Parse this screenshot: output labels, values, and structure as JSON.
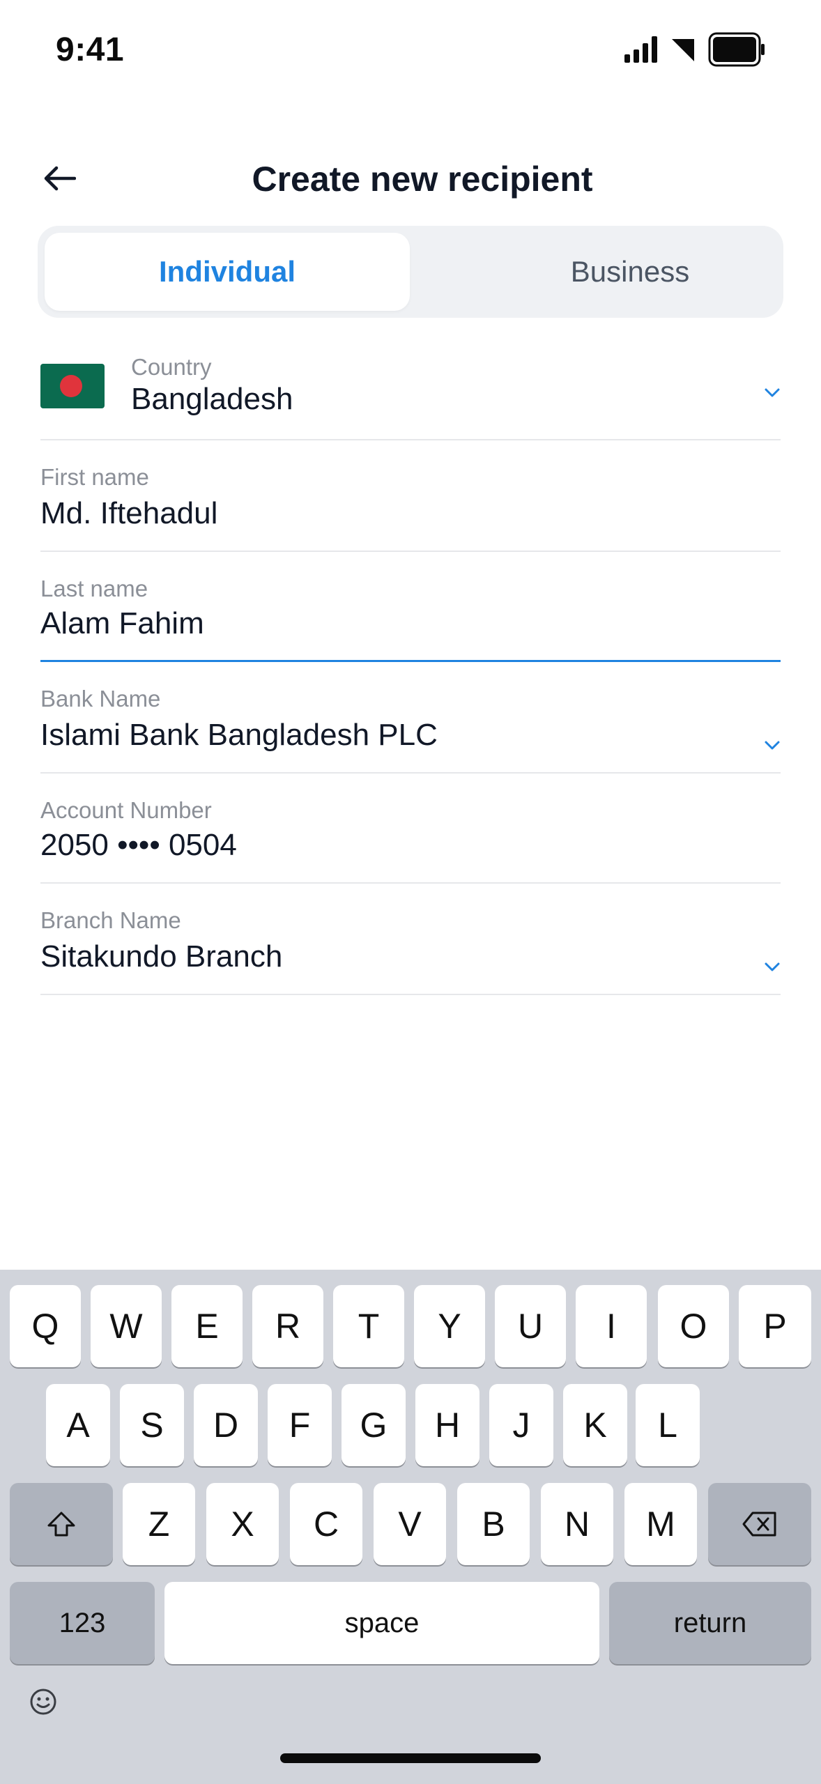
{
  "status_bar": {
    "time": "9:41"
  },
  "header": {
    "title": "Create new recipient"
  },
  "tabs": [
    {
      "label": "Individual",
      "selected": true
    },
    {
      "label": "Business",
      "selected": false
    }
  ],
  "form": {
    "country": {
      "label": "Country",
      "value": "Bangladesh",
      "flag": "bangladesh-flag"
    },
    "first_name": {
      "label": "First name",
      "value": "Md. Iftehadul"
    },
    "last_name": {
      "label": "Last name",
      "value": "Alam Fahim"
    },
    "bank_name": {
      "label": "Bank Name",
      "value": "Islami Bank Bangladesh PLC"
    },
    "account_number": {
      "label": "Account Number",
      "value": "2050 •••• 0504"
    },
    "branch_name": {
      "label": "Branch Name",
      "value": "Sitakundo Branch"
    }
  },
  "colors": {
    "accent": "#1f83e0",
    "keyboard_bg": "#d1d4db",
    "flag_green": "#0b6b4f",
    "flag_red": "#e0343c"
  },
  "keyboard": {
    "row1": [
      "Q",
      "W",
      "E",
      "R",
      "T",
      "Y",
      "U",
      "I",
      "O",
      "P"
    ],
    "row2": [
      "A",
      "S",
      "D",
      "F",
      "G",
      "H",
      "J",
      "K",
      "L"
    ],
    "row3": [
      "Z",
      "X",
      "C",
      "V",
      "B",
      "N",
      "M"
    ],
    "numbers_label": "123",
    "space_label": "space",
    "return_label": "return"
  }
}
